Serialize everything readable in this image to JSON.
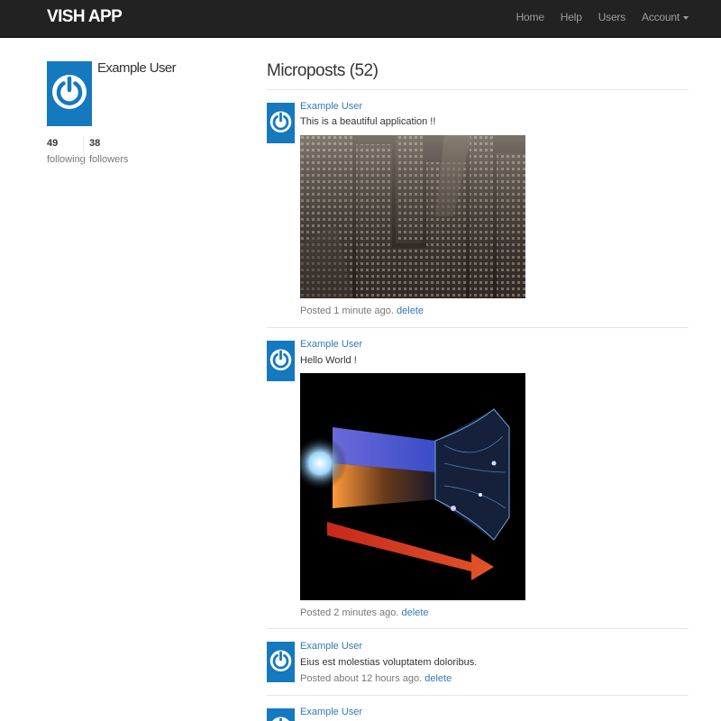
{
  "navbar": {
    "brand": "VISH APP",
    "links": [
      {
        "label": "Home"
      },
      {
        "label": "Help"
      },
      {
        "label": "Users"
      },
      {
        "label": "Account",
        "dropdown": true
      }
    ]
  },
  "colors": {
    "navbar_bg": "#222222",
    "avatar_blue": "#1479be",
    "link": "#337ab7",
    "muted": "#777777"
  },
  "profile": {
    "name": "Example User",
    "avatar_icon": "power-icon",
    "stats": {
      "following": {
        "count": "49",
        "label": "following"
      },
      "followers": {
        "count": "38",
        "label": "followers"
      }
    }
  },
  "feed": {
    "title": "Microposts (52)",
    "posts": [
      {
        "user": "Example User",
        "content": "This is a beautiful application !!",
        "image": "city-skyline-photo",
        "time": "Posted 1 minute ago.",
        "delete": "delete"
      },
      {
        "user": "Example User",
        "content": "Hello World !",
        "image": "universe-timeline-illustration",
        "time": "Posted 2 minutes ago.",
        "delete": "delete"
      },
      {
        "user": "Example User",
        "content": "Eius est molestias voluptatem doloribus.",
        "time": "Posted about 12 hours ago.",
        "delete": "delete"
      },
      {
        "user": "Example User"
      }
    ]
  }
}
